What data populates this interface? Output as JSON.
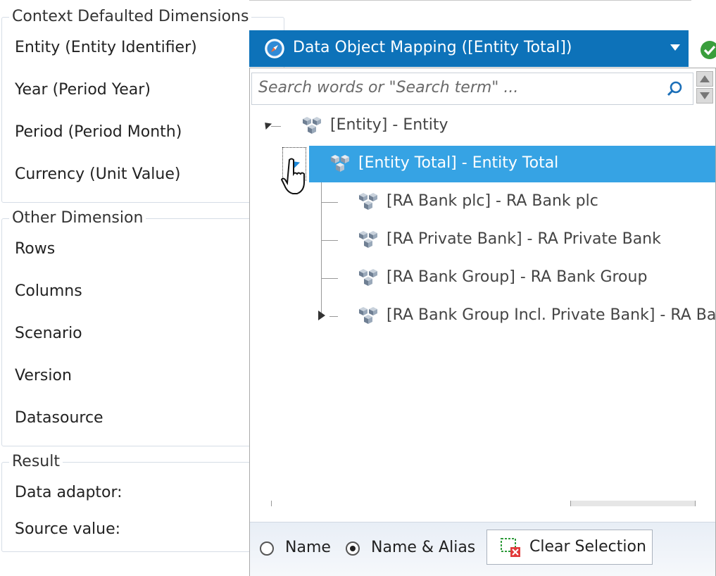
{
  "context_group": {
    "title": "Context Defaulted Dimensions",
    "fields": [
      "Entity (Entity Identifier)",
      "Year (Period Year)",
      "Period (Period Month)",
      "Currency (Unit Value)"
    ]
  },
  "other_group": {
    "title": "Other Dimension",
    "fields": [
      "Rows",
      "Columns",
      "Scenario",
      "Version",
      "Datasource"
    ]
  },
  "result_group": {
    "title": "Result",
    "fields": [
      "Data adaptor:",
      "Source value:"
    ]
  },
  "dropdown": {
    "selected_text": "Data Object Mapping ([Entity Total])",
    "header_color": "#0d72b9",
    "icon": "compass-icon",
    "status_icon": "check-ok-icon"
  },
  "search": {
    "placeholder": "Search words or \"Search term\" ..."
  },
  "tree": {
    "root": "[Entity] - Entity",
    "selected": "[Entity Total] - Entity Total",
    "selected_color": "#36a3e4",
    "children": [
      "[RA Bank plc] - RA Bank plc",
      "[RA Private Bank] - RA Private Bank",
      "[RA Bank Group] - RA Bank Group",
      "[RA Bank Group Incl. Private Bank] - RA Bank"
    ]
  },
  "footer": {
    "radio_name": "Name",
    "radio_name_alias": "Name & Alias",
    "selected_radio": "Name & Alias",
    "clear_button": "Clear Selection"
  }
}
